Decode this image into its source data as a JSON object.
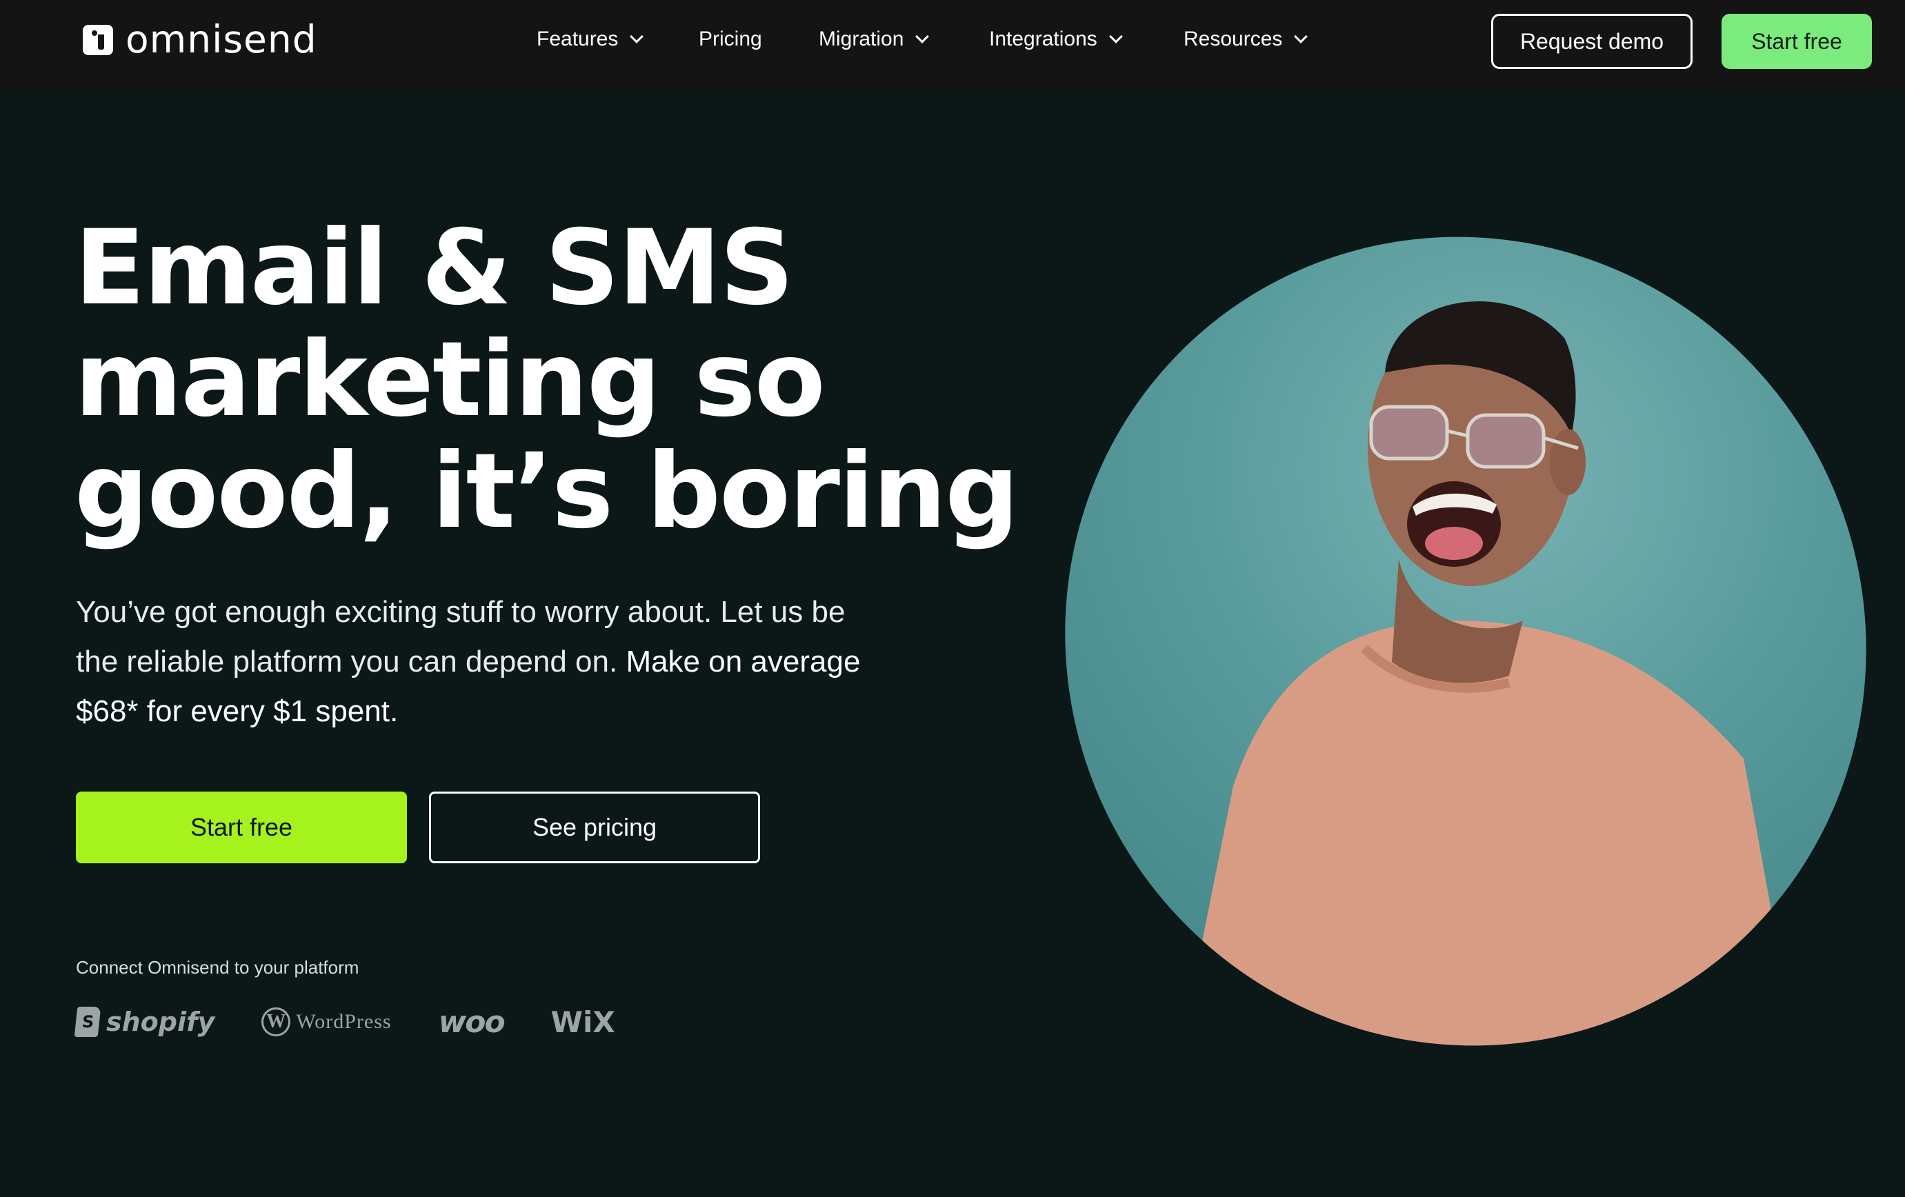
{
  "brand": {
    "name": "omnisend"
  },
  "nav": {
    "items": [
      {
        "label": "Features",
        "dropdown": true
      },
      {
        "label": "Pricing",
        "dropdown": false
      },
      {
        "label": "Migration",
        "dropdown": true
      },
      {
        "label": "Integrations",
        "dropdown": true
      },
      {
        "label": "Resources",
        "dropdown": true
      }
    ],
    "request_demo": "Request demo",
    "start_free": "Start free"
  },
  "hero": {
    "headline": [
      "Email & SMS",
      "marketing so",
      "good, it’s boring"
    ],
    "subtext": "You’ve got enough exciting stuff to worry about. Let us be the reliable platform you can depend on.",
    "subtext_highlight": "Make on average $68* for every $1 spent.",
    "primary_cta": "Start free",
    "secondary_cta": "See pricing",
    "connect_label": "Connect Omnisend to your platform",
    "platforms": [
      "shopify",
      "WordPress",
      "woo",
      "WiX"
    ]
  },
  "colors": {
    "background": "#0b1817",
    "topbar": "#141414",
    "accent_green": "#7ceb7d",
    "cta_lime": "#a6f21c",
    "image_bg": "#5a9c9d"
  },
  "icons": [
    "omnisend-logo-icon",
    "chevron-down-icon",
    "shopify-logo",
    "wordpress-logo",
    "woo-logo",
    "wix-logo"
  ]
}
